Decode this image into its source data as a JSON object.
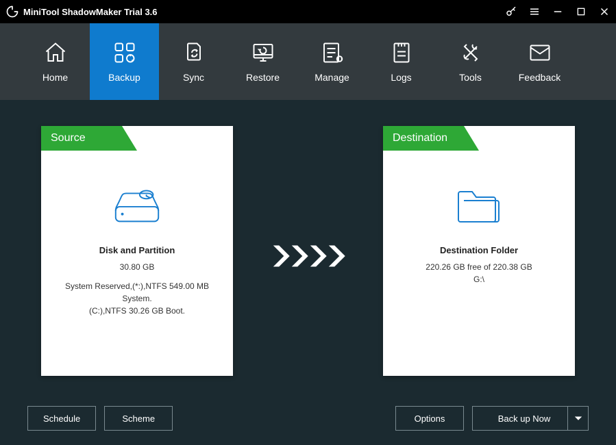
{
  "title": "MiniTool ShadowMaker Trial 3.6",
  "nav": [
    {
      "label": "Home"
    },
    {
      "label": "Backup"
    },
    {
      "label": "Sync"
    },
    {
      "label": "Restore"
    },
    {
      "label": "Manage"
    },
    {
      "label": "Logs"
    },
    {
      "label": "Tools"
    },
    {
      "label": "Feedback"
    }
  ],
  "nav_active_index": 1,
  "source": {
    "tab": "Source",
    "title": "Disk and Partition",
    "size": "30.80 GB",
    "detail1": "System Reserved,(*:),NTFS 549.00 MB System.",
    "detail2": "(C:),NTFS 30.26 GB Boot."
  },
  "destination": {
    "tab": "Destination",
    "title": "Destination Folder",
    "line1": "220.26 GB free of 220.38 GB",
    "line2": "G:\\"
  },
  "buttons": {
    "schedule": "Schedule",
    "scheme": "Scheme",
    "options": "Options",
    "backup_now": "Back up Now"
  }
}
